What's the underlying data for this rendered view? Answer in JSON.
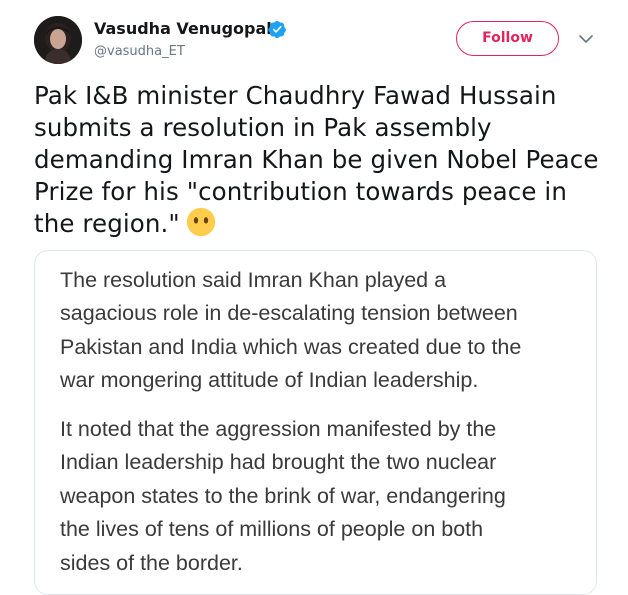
{
  "tweet": {
    "author": {
      "display_name": "Vasudha Venugopal",
      "handle": "@vasudha_ET",
      "verified": true,
      "avatar_icon": "profile-photo"
    },
    "follow_label": "Follow",
    "more_icon": "chevron-down-icon",
    "text_lines": [
      "Pak I&B minister Chaudhry Fawad Hussain",
      "submits a resolution in Pak assembly",
      "demanding Imran Khan be given Nobel Peace",
      "Prize for his \"contribution towards peace in",
      "the region.\""
    ],
    "emoji": "face-without-mouth-emoji",
    "quoted_text": {
      "paragraph_1": [
        "The resolution said Imran Khan played a",
        "sagacious role in de-escalating tension between",
        "Pakistan and India which was created due to the",
        "war mongering attitude of Indian leadership."
      ],
      "paragraph_2": [
        "It noted that the aggression manifested by the",
        "Indian leadership had brought the two nuclear",
        "weapon states to the brink of war, endangering",
        "the lives of tens of millions of people on both",
        "sides of the border."
      ]
    }
  },
  "colors": {
    "follow_accent": "#e0245e",
    "verified_blue": "#1da1f2",
    "text_primary": "#14171a",
    "text_secondary": "#657786",
    "card_border": "#e1e8ed",
    "card_text": "#3a3a3a",
    "emoji_yellow": "#ffcc4d"
  }
}
